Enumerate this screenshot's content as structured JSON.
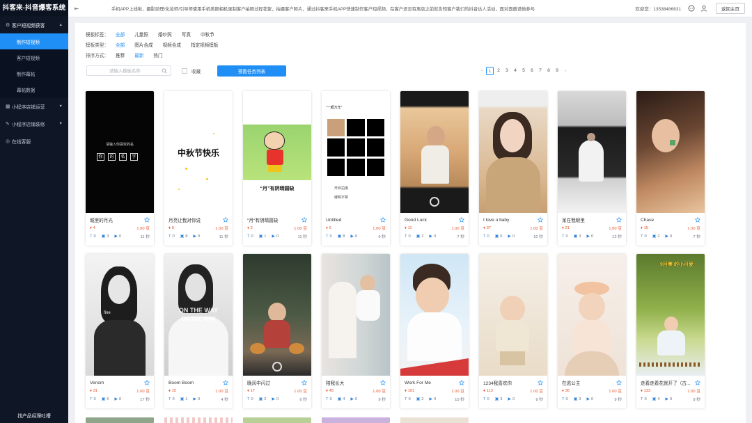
{
  "app": {
    "title": "抖客来-抖音爆客系统"
  },
  "sidebar": {
    "group_main": "客户短视频获客",
    "items": [
      "制作短视频",
      "客户短视频",
      "制作幕帖",
      "幕帖数据"
    ],
    "groups": [
      "小程序店铺运营",
      "小程序店铺装修",
      "在线客服"
    ],
    "footer": "找产品经理吐槽"
  },
  "topbar": {
    "notice": "手机APP上线啦，摄影助理/化妆师/引导师使用手机美颜相机录制客户拍照过程花絮，拍摄客户照片，通过抖客来手机APP快速制作客户短视频，在客户还没有离店之前就告知客户我们的抖音达人活动，面对面邀请他参与",
    "welcome": "欢迎您：13538486831",
    "back_label": "返回主页"
  },
  "filters": {
    "tag_label": "模板标签：",
    "tags": [
      "全部",
      "儿童照",
      "婚纱照",
      "写真",
      "中秋节"
    ],
    "type_label": "模板类型：",
    "types": [
      "全部",
      "图片合成",
      "视频合成",
      "指定视频模板"
    ],
    "sort_label": "排序方式：",
    "sorts": [
      "推荐",
      "最新",
      "热门"
    ]
  },
  "search": {
    "placeholder": "请输入模板名称"
  },
  "favorites_label": "收藏",
  "preset_button": "预置任务列表",
  "pagination": {
    "prev": "‹",
    "pages": [
      "1",
      "2",
      "3",
      "4",
      "5",
      "6",
      "7",
      "8",
      "9"
    ],
    "next": "›",
    "current": "1"
  },
  "cards": [
    {
      "title": "城里的月光",
      "heat": "4",
      "price": "1.00 豆",
      "a": "0",
      "b": "3",
      "c": "0",
      "dur": "11 秒"
    },
    {
      "title": "月亮让我对你说",
      "heat": "9",
      "price": "1.00 豆",
      "a": "0",
      "b": "8",
      "c": "0",
      "dur": "11 秒"
    },
    {
      "title": "\"月\"有阴晴圆缺",
      "heat": "2",
      "price": "1.00 豆",
      "a": "0",
      "b": "1",
      "c": "0",
      "dur": "11 秒"
    },
    {
      "title": "Untitled",
      "heat": "6",
      "price": "1.00 豆",
      "a": "0",
      "b": "8",
      "c": "0",
      "dur": "9 秒"
    },
    {
      "title": "Good Luck",
      "heat": "11",
      "price": "1.00 豆",
      "a": "0",
      "b": "2",
      "c": "0",
      "dur": "7 秒"
    },
    {
      "title": "I love u baby",
      "heat": "37",
      "price": "1.00 豆",
      "a": "0",
      "b": "5",
      "c": "0",
      "dur": "10 秒"
    },
    {
      "title": "呆在我眼里",
      "heat": "21",
      "price": "1.00 豆",
      "a": "0",
      "b": "3",
      "c": "0",
      "dur": "12 秒"
    },
    {
      "title": "Chase",
      "heat": "15",
      "price": "1.00 豆",
      "a": "0",
      "b": "2",
      "c": "0",
      "dur": "7 秒"
    },
    {
      "title": "Venom",
      "heat": "31",
      "price": "1.00 豆",
      "a": "0",
      "b": "6",
      "c": "0",
      "dur": "17 秒"
    },
    {
      "title": "Boom Boom",
      "heat": "15",
      "price": "1.00 豆",
      "a": "0",
      "b": "1",
      "c": "0",
      "dur": "4 秒"
    },
    {
      "title": "晚风中闪过",
      "heat": "17",
      "price": "1.00 豆",
      "a": "0",
      "b": "2",
      "c": "0",
      "dur": "6 秒"
    },
    {
      "title": "陪我长大",
      "heat": "45",
      "price": "1.00 豆",
      "a": "0",
      "b": "4",
      "c": "0",
      "dur": "9 秒"
    },
    {
      "title": "Work For Me",
      "heat": "101",
      "price": "1.00 豆",
      "a": "0",
      "b": "2",
      "c": "0",
      "dur": "10 秒"
    },
    {
      "title": "1234我喜欢你",
      "heat": "113",
      "price": "1.00 豆",
      "a": "0",
      "b": "3",
      "c": "0",
      "dur": "9 秒"
    },
    {
      "title": "在逃公主",
      "heat": "36",
      "price": "1.00 豆",
      "a": "0",
      "b": "3",
      "c": "0",
      "dur": "9 秒"
    },
    {
      "title": "走着走着花就开了（古...",
      "heat": "133",
      "price": "1.00 豆",
      "a": "0",
      "b": "4",
      "c": "0",
      "dur": "9 秒"
    }
  ],
  "thumb_text": {
    "t1": "请输入你喜欢的名",
    "t1_chars": [
      "你",
      "的",
      "名",
      "字"
    ],
    "t2": "中秋节快乐",
    "t3": "“月”有阴晴圆缺",
    "t4_head": "“一眼万年”",
    "t4_row1": "开启拍摄",
    "t4_row2": "编辑字幕",
    "t9": "fine",
    "t10a": "ON THE WAY",
    "t10b": "ON THE WAY",
    "t16": "9月零 的小可爱"
  },
  "colors": {
    "accent": "#1f8ff6",
    "sidebar_bg": "#0f1727",
    "price": "#e4552e"
  }
}
